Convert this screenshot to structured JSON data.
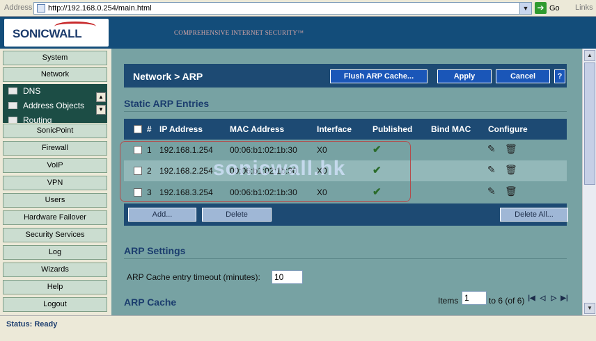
{
  "browser": {
    "address_label": "Address",
    "url": "http://192.168.0.254/main.html",
    "go_label": "Go",
    "links_label": "Links"
  },
  "header": {
    "logo_text": "SONICWALL",
    "tagline": "COMPREHENSIVE INTERNET SECURITY™"
  },
  "sidebar": {
    "items": [
      "System",
      "Network",
      "SonicPoint",
      "Firewall",
      "VoIP",
      "VPN",
      "Users",
      "Hardware Failover",
      "Security Services",
      "Log",
      "Wizards",
      "Help",
      "Logout"
    ],
    "network_sub": [
      "DNS",
      "Address Objects",
      "Routing"
    ]
  },
  "page": {
    "title": "Network > ARP",
    "buttons": {
      "flush": "Flush ARP Cache...",
      "apply": "Apply",
      "cancel": "Cancel",
      "help": "?"
    }
  },
  "static_arp": {
    "section_title": "Static ARP Entries",
    "columns": {
      "num": "#",
      "ip": "IP Address",
      "mac": "MAC Address",
      "iface": "Interface",
      "published": "Published",
      "bind": "Bind MAC",
      "configure": "Configure"
    },
    "rows": [
      {
        "num": "1",
        "ip": "192.168.1.254",
        "mac": "00:06:b1:02:1b:30",
        "iface": "X0",
        "published": true
      },
      {
        "num": "2",
        "ip": "192.168.2.254",
        "mac": "00:06:b1:02:1b:30",
        "iface": "X0",
        "published": true
      },
      {
        "num": "3",
        "ip": "192.168.3.254",
        "mac": "00:06:b1:02:1b:30",
        "iface": "X0",
        "published": true
      }
    ],
    "add_label": "Add...",
    "delete_label": "Delete",
    "delete_all_label": "Delete All..."
  },
  "arp_settings": {
    "section_title": "ARP Settings",
    "timeout_label": "ARP Cache entry timeout (minutes):",
    "timeout_value": "10"
  },
  "arp_cache": {
    "section_title": "ARP Cache",
    "items_label": "Items",
    "items_value": "1",
    "items_range": "to 6 (of 6)"
  },
  "watermark": "sonicwall.hk",
  "status": {
    "text": "Status: Ready"
  },
  "colors": {
    "banner": "#134d7a",
    "panel": "#1d4a73",
    "content_bg": "#77a2a3",
    "button_blue": "#1a56b8"
  }
}
